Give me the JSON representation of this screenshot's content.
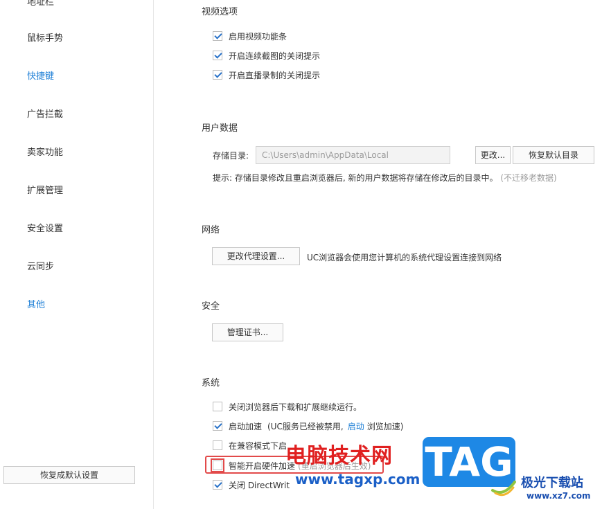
{
  "sidebar": {
    "items": [
      {
        "label": "地址栏",
        "active": false
      },
      {
        "label": "鼠标手势",
        "active": false
      },
      {
        "label": "快捷键",
        "active": true
      },
      {
        "label": "广告拦截",
        "active": false
      },
      {
        "label": "卖家功能",
        "active": false
      },
      {
        "label": "扩展管理",
        "active": false
      },
      {
        "label": "安全设置",
        "active": false
      },
      {
        "label": "云同步",
        "active": false
      },
      {
        "label": "其他",
        "active": true
      }
    ],
    "reset_all_label": "恢复成默认设置"
  },
  "video": {
    "title": "视频选项",
    "options": [
      {
        "label": "启用视频功能条",
        "checked": true
      },
      {
        "label": "开启连续截图的关闭提示",
        "checked": true
      },
      {
        "label": "开启直播录制的关闭提示",
        "checked": true
      }
    ]
  },
  "user_data": {
    "title": "用户数据",
    "storage_label": "存储目录:",
    "storage_path": "C:\\Users\\admin\\AppData\\Local",
    "change_label": "更改...",
    "restore_label": "恢复默认目录",
    "hint": "提示: 存储目录修改且重启浏览器后, 新的用户数据将存储在修改后的目录中。",
    "hint_note": "(不迁移老数据)"
  },
  "network": {
    "title": "网络",
    "proxy_button": "更改代理设置...",
    "proxy_desc": "UC浏览器会使用您计算机的系统代理设置连接到网络"
  },
  "security": {
    "title": "安全",
    "cert_button": "管理证书..."
  },
  "system": {
    "title": "系统",
    "opt1_label": "关闭浏览器后下载和扩展继续运行。",
    "opt1_checked": false,
    "opt2_label": "启动加速",
    "opt2_note_a": "(UC服务已经被禁用,",
    "opt2_link": "启动",
    "opt2_note_b": "浏览加速)",
    "opt2_checked": true,
    "opt3_label": "在兼容模式下启",
    "opt3_checked": false,
    "opt4_label": "智能开启硬件加速",
    "opt4_note": "(重启浏览器后生效)",
    "opt4_checked": false,
    "opt5_label": "关闭 DirectWrit",
    "opt5_checked": true
  },
  "watermark": {
    "site_name": "电脑技术网",
    "site_url": "www.tagxp.com",
    "logo_text": "TAG",
    "brand_name": "极光下载站",
    "brand_url": "www.xz7.com"
  },
  "colors": {
    "accent": "#1e7fd6",
    "checkmark": "#2a73c9",
    "highlight_box": "#e24a4a",
    "watermark_red": "#e02020",
    "logo_blue": "#1e88e5"
  }
}
